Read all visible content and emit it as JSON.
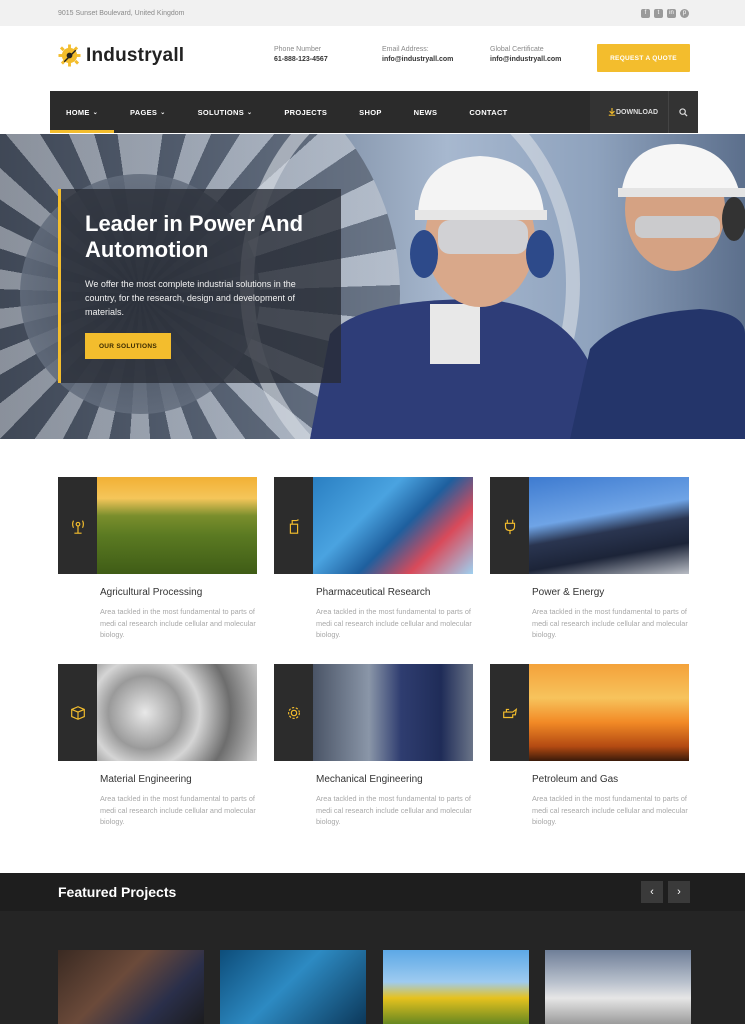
{
  "topbar": {
    "address": "9015 Sunset Boulevard, United Kingdom",
    "social_icons": [
      "facebook-icon",
      "twitter-icon",
      "linkedin-icon",
      "pinterest-icon"
    ]
  },
  "header": {
    "logo_text": "Industryall",
    "phone_label": "Phone Number",
    "phone_value": "61-888-123-4567",
    "email_label": "Email Address:",
    "email_value": "info@industryall.com",
    "cert_label": "Global Certificate",
    "cert_value": "info@industryall.com",
    "quote_button": "REQUEST A QUOTE"
  },
  "nav": {
    "items": [
      {
        "label": "HOME",
        "dropdown": true
      },
      {
        "label": "PAGES",
        "dropdown": true
      },
      {
        "label": "SOLUTIONS",
        "dropdown": true
      },
      {
        "label": "PROJECTS",
        "dropdown": false
      },
      {
        "label": "SHOP",
        "dropdown": false
      },
      {
        "label": "NEWS",
        "dropdown": false
      },
      {
        "label": "CONTACT",
        "dropdown": false
      }
    ],
    "download": "DOWNLOAD"
  },
  "hero": {
    "title": "Leader in Power And Automotion",
    "text": "We offer the most complete industrial solutions in the country, for the research, design and development of materials.",
    "button": "OUR SOLUTIONS"
  },
  "services": [
    {
      "title": "Agricultural Processing",
      "desc": "Area tackled in the most fundamental to parts of medi cal research include cellular and molecular biology.",
      "icon": "antenna-icon"
    },
    {
      "title": "Pharmaceutical Research",
      "desc": "Area tackled in the most fundamental to parts of medi cal research include cellular and molecular biology.",
      "icon": "spray-bottle-icon"
    },
    {
      "title": "Power & Energy",
      "desc": "Area tackled in the most fundamental to parts of medi cal research include cellular and molecular biology.",
      "icon": "plug-icon"
    },
    {
      "title": "Material Engineering",
      "desc": "Area tackled in the most fundamental to parts of medi cal research include cellular and molecular biology.",
      "icon": "box-icon"
    },
    {
      "title": "Mechanical Engineering",
      "desc": "Area tackled in the most fundamental to parts of medi cal research include cellular and molecular biology.",
      "icon": "gear-icon"
    },
    {
      "title": "Petroleum and Gas",
      "desc": "Area tackled in the most fundamental to parts of medi cal research include cellular and molecular biology.",
      "icon": "oil-can-icon"
    }
  ],
  "featured": {
    "title": "Featured Projects",
    "prev": "‹",
    "next": "›"
  },
  "colors": {
    "accent": "#f3bd2d",
    "dark": "#2b2b2b"
  }
}
